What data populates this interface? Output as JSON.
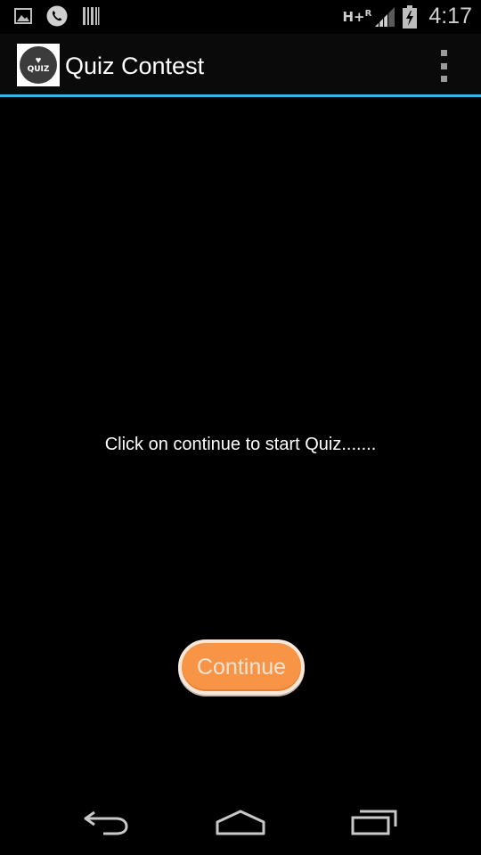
{
  "status_bar": {
    "network_type": "H+",
    "roaming": "R",
    "time": "4:17",
    "icons": [
      "image-icon",
      "phone-icon",
      "barcode-icon",
      "signal-icon",
      "battery-charging-icon"
    ]
  },
  "action_bar": {
    "logo_text": "QUIZ",
    "title": "Quiz Contest",
    "menu_icon": "overflow-menu-icon"
  },
  "main": {
    "prompt": "Click on continue to start Quiz.......",
    "continue_label": "Continue"
  },
  "nav_bar": {
    "icons": [
      "back-icon",
      "home-icon",
      "recent-apps-icon"
    ]
  },
  "colors": {
    "background": "#000000",
    "accent_line": "#33b5e5",
    "button_fill": "#f79446",
    "button_border": "#fbe7da",
    "button_text": "#fbe3d2"
  }
}
